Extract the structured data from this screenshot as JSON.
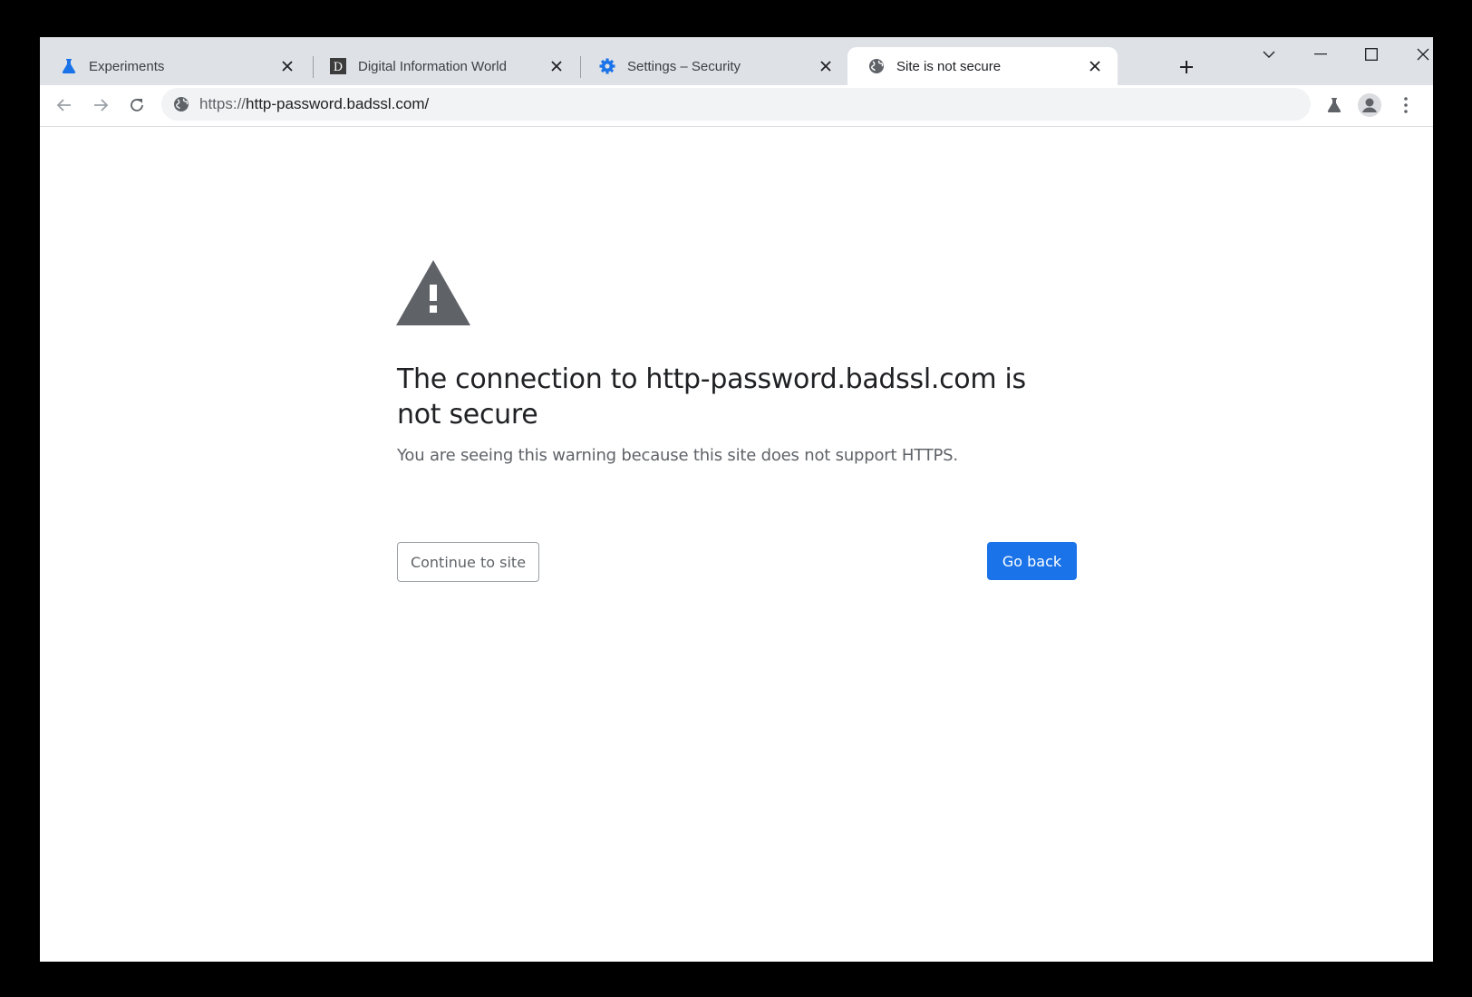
{
  "browser": {
    "tabs": [
      {
        "title": "Experiments",
        "icon": "flask-icon",
        "active": false
      },
      {
        "title": "Digital Information World",
        "icon": "site-d-icon",
        "active": false
      },
      {
        "title": "Settings – Security",
        "icon": "gear-icon",
        "active": false
      },
      {
        "title": "Site is not secure",
        "icon": "globe-icon",
        "active": true
      }
    ],
    "favicon_letter": "D",
    "omnibox": {
      "url_scheme": "https://",
      "url_host": "http-password.badssl.com/"
    }
  },
  "interstitial": {
    "headline": "The connection to http-password.badssl.com is not secure",
    "explanation": "You are seeing this warning because this site does not support HTTPS.",
    "continue_label": "Continue to site",
    "go_back_label": "Go back"
  },
  "colors": {
    "tabstrip_bg": "#dee1e6",
    "accent": "#1a73e8",
    "warning_icon": "#5f6368"
  }
}
